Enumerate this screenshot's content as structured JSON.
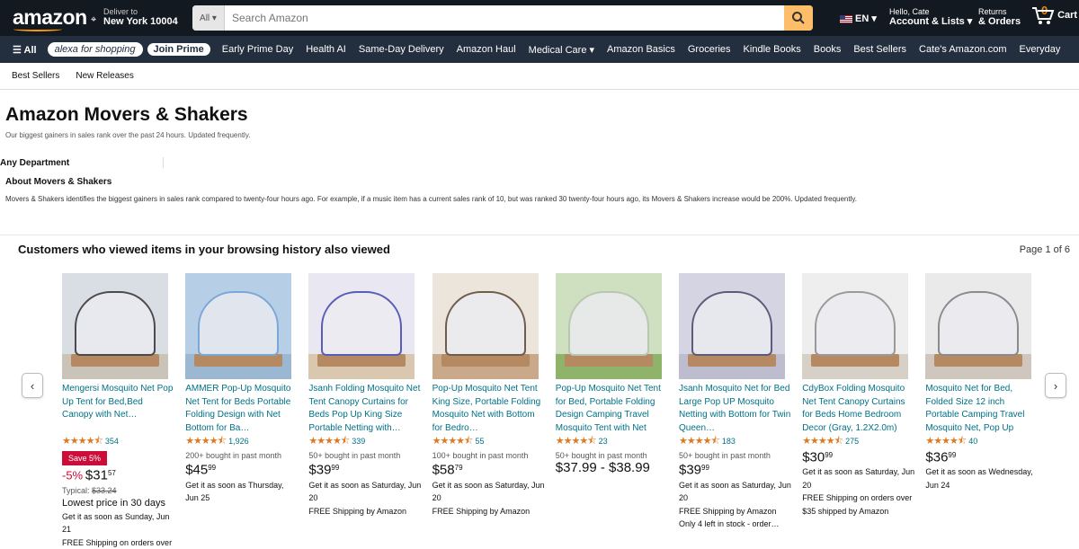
{
  "header": {
    "logo": "amazon",
    "deliver_to": "Deliver to",
    "location": "New York 10004",
    "search_category": "All",
    "search_placeholder": "Search Amazon",
    "language": "EN",
    "greeting": "Hello, Cate",
    "account_label": "Account & Lists",
    "returns_label": "Returns",
    "orders_label": "& Orders",
    "cart_count": "0",
    "cart_label": "Cart"
  },
  "nav": {
    "all": "All",
    "alexa": "alexa for shopping",
    "join_prime": "Join Prime",
    "items": [
      "Early Prime Day",
      "Health AI",
      "Same-Day Delivery",
      "Amazon Haul",
      "Medical Care",
      "Amazon Basics",
      "Groceries",
      "Kindle Books",
      "Books",
      "Best Sellers",
      "Cate's Amazon.com",
      "Everyday"
    ]
  },
  "subnav": {
    "items": [
      "Best Sellers",
      "New Releases"
    ]
  },
  "page": {
    "title": "Amazon Movers & Shakers",
    "subtitle": "Our biggest gainers in sales rank over the past 24 hours. Updated frequently.",
    "department": "Any Department",
    "about_title": "About Movers & Shakers",
    "about_text": "Movers & Shakers identifies the biggest gainers in sales rank compared to twenty-four hours ago. For example, if a music item has a current sales rank of 10, but was ranked 30 twenty-four hours ago, its Movers & Shakers increase would be 200%. Updated frequently."
  },
  "carousel": {
    "heading": "Customers who viewed items in your browsing history also viewed",
    "page": "Page 1 of 6",
    "products": [
      {
        "title": "Mengersi Mosquito Net Pop Up Tent for Bed,Bed Canopy with Net…",
        "stars": 4.5,
        "reviews": "354",
        "deal": "Save 5%",
        "discount": "-5%",
        "price_whole": "$31",
        "price_frac": "57",
        "typical_label": "Typical:",
        "typical": "$33.24",
        "lowest": "Lowest price in 30 days",
        "delivery": "Get it as soon as Sunday, Jun 21",
        "shipping": "FREE Shipping on orders over",
        "wall": "#d9dee4",
        "floor": "#c9c3b8",
        "tent": "#4b4b4b"
      },
      {
        "title": "AMMER Pop-Up Mosquito Net Tent for Beds Portable Folding Design with Net Bottom for Ba…",
        "stars": 4.5,
        "reviews": "1,926",
        "bought": "200+ bought in past month",
        "price_whole": "$45",
        "price_frac": "99",
        "delivery": "Get it as soon as Thursday, Jun 25",
        "wall": "#b7cfe6",
        "floor": "#9bb7d2",
        "tent": "#7aa7d8"
      },
      {
        "title": "Jsanh Folding Mosquito Net Tent Canopy Curtains for Beds Pop Up King Size Portable Netting with…",
        "stars": 4.5,
        "reviews": "339",
        "bought": "50+ bought in past month",
        "price_whole": "$39",
        "price_frac": "99",
        "delivery": "Get it as soon as Saturday, Jun 20",
        "shipping": "FREE Shipping by Amazon",
        "wall": "#e9e8f2",
        "floor": "#d9c7b0",
        "tent": "#5a5db8"
      },
      {
        "title": "Pop-Up Mosquito Net Tent King Size, Portable Folding Mosquito Net with Bottom for Bedro…",
        "stars": 4.5,
        "reviews": "55",
        "bought": "100+ bought in past month",
        "price_whole": "$58",
        "price_frac": "79",
        "delivery": "Get it as soon as Saturday, Jun 20",
        "shipping": "FREE Shipping by Amazon",
        "wall": "#ece5dc",
        "floor": "#c9a98a",
        "tent": "#6f5d4c"
      },
      {
        "title": "Pop-Up Mosquito Net Tent for Bed, Portable Folding Design Camping Travel Mosquito Tent with Net Bottom for Baby…",
        "stars": 4.5,
        "reviews": "23",
        "bought": "50+ bought in past month",
        "price_range": "$37.99 - $38.99",
        "delivery": "",
        "wall": "#cfe0c0",
        "floor": "#8fb36a",
        "tent": "#b9c7b0"
      },
      {
        "title": "Jsanh Mosquito Net for Bed Large Pop UP Mosquito Netting with Bottom for Twin Queen…",
        "stars": 4.5,
        "reviews": "183",
        "bought": "50+ bought in past month",
        "price_whole": "$39",
        "price_frac": "99",
        "delivery": "Get it as soon as Saturday, Jun 20",
        "shipping": "FREE Shipping by Amazon",
        "stock": "Only 4 left in stock - order…",
        "wall": "#d4d4e3",
        "floor": "#bdbdcf",
        "tent": "#5c5c7a"
      },
      {
        "title": "CdyBox Folding Mosquito Net Tent Canopy Curtains for Beds Home Bedroom Decor (Gray, 1.2X2.0m)",
        "stars": 4.5,
        "reviews": "275",
        "price_whole": "$30",
        "price_frac": "99",
        "delivery": "Get it as soon as Saturday, Jun 20",
        "shipping": "FREE Shipping on orders over $35 shipped by Amazon",
        "wall": "#eeeeee",
        "floor": "#d6d0c6",
        "tent": "#9a9a9a"
      },
      {
        "title": "Mosquito Net for Bed, Folded Size 12 inch Portable Camping Travel Mosquito Net, Pop Up Mosquito Tent with…",
        "stars": 4.5,
        "reviews": "40",
        "price_whole": "$36",
        "price_frac": "99",
        "delivery": "Get it as soon as Wednesday, Jun 24",
        "wall": "#eaeaea",
        "floor": "#cfc6bd",
        "tent": "#8b8b8b"
      }
    ]
  }
}
